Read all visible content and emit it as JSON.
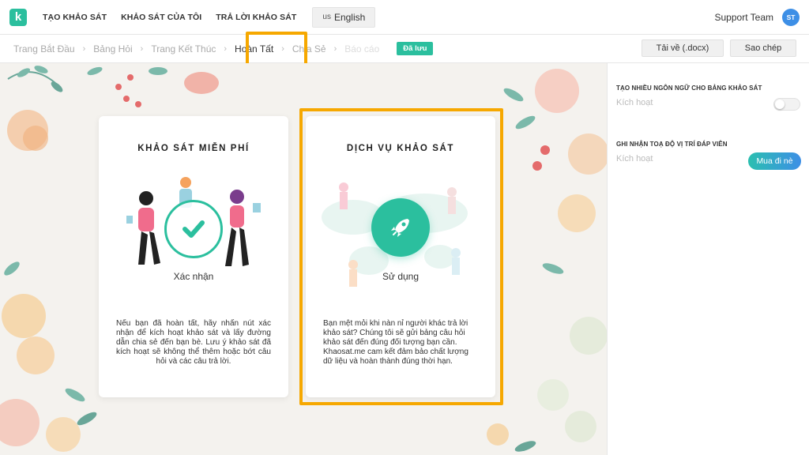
{
  "topbar": {
    "logo_letter": "k",
    "nav": [
      "TẠO KHẢO SÁT",
      "KHẢO SÁT CỦA TÔI",
      "TRẢ LỜI KHẢO SÁT"
    ],
    "lang_flag": "us",
    "lang_label": "English",
    "support": "Support Team",
    "avatar_initials": "ST"
  },
  "breadcrumb": {
    "items": [
      "Trang Bắt Đầu",
      "Bảng Hỏi",
      "Trang Kết Thúc",
      "Hoàn Tất",
      "Chia Sẻ",
      "Báo cáo"
    ],
    "separator": "›",
    "active_index": 3,
    "saved_badge": "Đã lưu",
    "download_label": "Tải về (.docx)",
    "copy_label": "Sao chép"
  },
  "cards": [
    {
      "title": "KHẢO SÁT MIỄN PHÍ",
      "action_label": "Xác nhận",
      "icon": "check-icon",
      "description": "Nếu bạn đã hoàn tất, hãy nhấn nút xác nhận để kích hoạt khảo sát và lấy đường dẫn chia sẻ đến bạn bè. Lưu ý khảo sát đã kích hoạt sẽ không thể thêm hoặc bớt câu hỏi và các câu trả lời."
    },
    {
      "title": "DỊCH VỤ KHẢO SÁT",
      "action_label": "Sử dụng",
      "icon": "rocket-icon",
      "description": "Bạn mệt mỏi khi nàn nỉ người khác trả lời khảo sát? Chúng tôi sẽ gửi bảng câu hỏi khảo sát đến đúng đối tượng bạn cần. Khaosat.me cam kết đảm bảo chất lượng dữ liệu và hoàn thành đúng thời hạn."
    }
  ],
  "right_panel": {
    "multilang_heading": "TẠO NHIỀU NGÔN NGỮ CHO BẢNG KHẢO SÁT",
    "multilang_sub": "Kích hoạt",
    "multilang_enabled": false,
    "geo_heading": "GHI NHẬN TOẠ ĐỘ VỊ TRÍ ĐÁP VIÊN",
    "geo_sub": "Kích hoạt",
    "buy_label": "Mua đi nè"
  },
  "colors": {
    "accent": "#2bbf9e",
    "highlight": "#f6a800",
    "avatar": "#3d8fe6"
  }
}
